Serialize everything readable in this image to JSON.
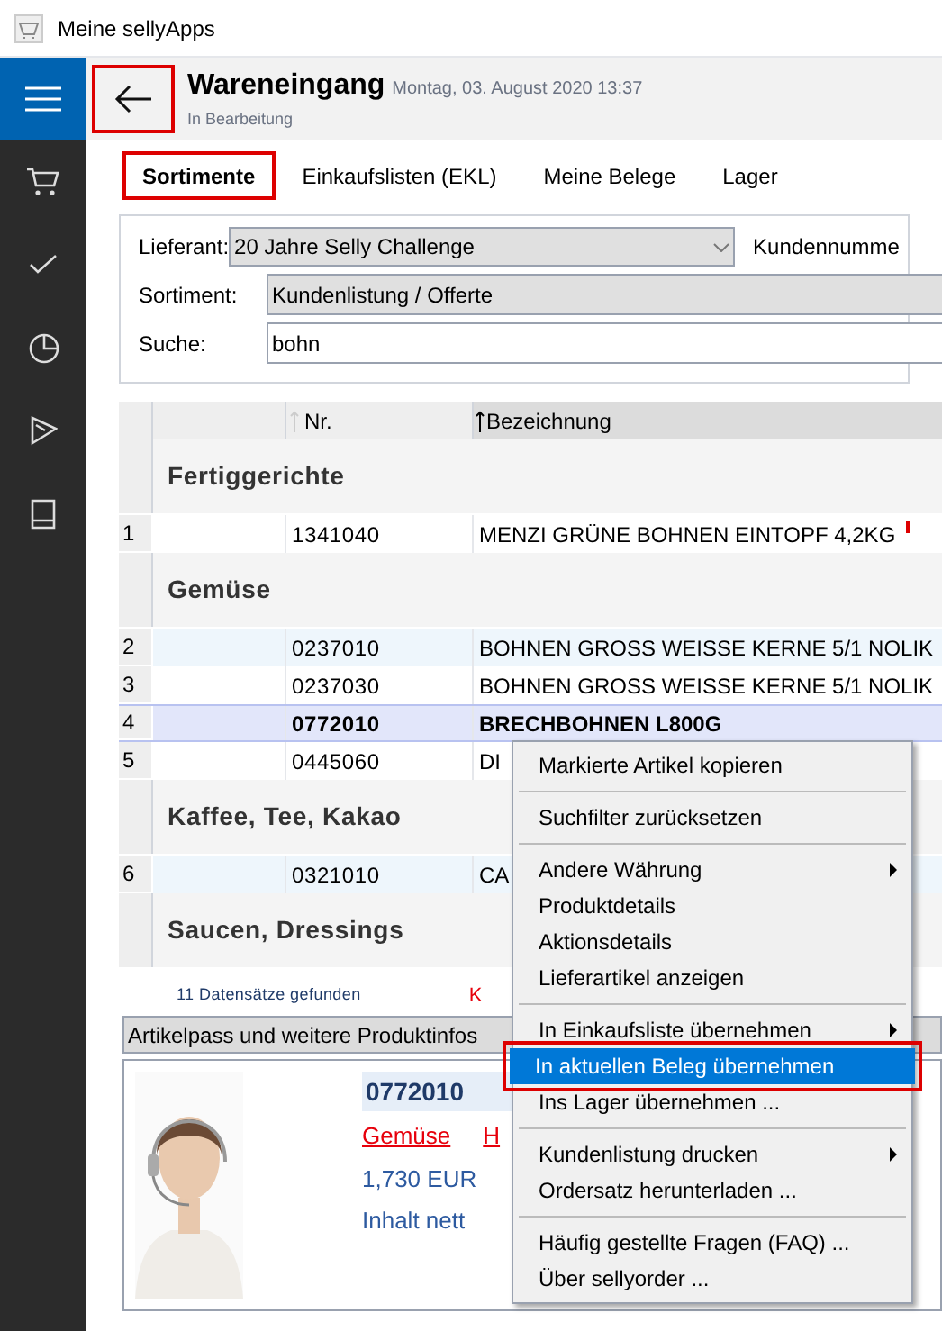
{
  "window": {
    "title": "Meine sellyApps"
  },
  "header": {
    "title": "Wareneingang",
    "date": "Montag, 03. August 2020 13:37",
    "status": "In Bearbeitung",
    "back_highlighted": true
  },
  "tabs": [
    {
      "label": "Sortimente",
      "selected": true,
      "highlighted": true
    },
    {
      "label": "Einkaufslisten (EKL)",
      "selected": false,
      "highlighted": false
    },
    {
      "label": "Meine Belege",
      "selected": false,
      "highlighted": false
    },
    {
      "label": "Lager",
      "selected": false,
      "highlighted": false
    }
  ],
  "filters": {
    "lieferant_label": "Lieferant:",
    "lieferant_value": "20 Jahre Selly Challenge",
    "kunden_label": "Kundennumme",
    "sortiment_label": "Sortiment:",
    "sortiment_value": "Kundenlistung / Offerte",
    "suche_label": "Suche:",
    "suche_value": "bohn"
  },
  "table": {
    "columns": [
      "Nr.",
      "Bezeichnung"
    ],
    "rows": [
      {
        "kind": "group",
        "title": "Fertiggerichte"
      },
      {
        "kind": "item",
        "index": "1",
        "nr": "1341040",
        "name": "MENZI GRÜNE BOHNEN EINTOPF 4,2KG",
        "info": true,
        "selected": false,
        "shaded": false
      },
      {
        "kind": "group",
        "title": "Gemüse"
      },
      {
        "kind": "item",
        "index": "2",
        "nr": "0237010",
        "name": "BOHNEN GROSS WEISSE KERNE 5/1 NOLIK",
        "info": false,
        "selected": false,
        "shaded": true
      },
      {
        "kind": "item",
        "index": "3",
        "nr": "0237030",
        "name": "BOHNEN GROSS WEISSE KERNE 5/1 NOLIK",
        "info": false,
        "selected": false,
        "shaded": false
      },
      {
        "kind": "item",
        "index": "4",
        "nr": "0772010",
        "name": "BRECHBOHNEN L800G",
        "info": false,
        "selected": true,
        "shaded": false
      },
      {
        "kind": "item",
        "index": "5",
        "nr": "0445060",
        "name": "DI",
        "info": false,
        "selected": false,
        "shaded": false
      },
      {
        "kind": "group",
        "title": "Kaffee, Tee, Kakao"
      },
      {
        "kind": "item",
        "index": "6",
        "nr": "0321010",
        "name": "CA",
        "info": false,
        "selected": false,
        "shaded": true
      },
      {
        "kind": "group",
        "title": "Saucen, Dressings"
      }
    ]
  },
  "footer": {
    "count": "11 Datensätze gefunden",
    "link": "K"
  },
  "product_panel": {
    "title": "Artikelpass und weitere Produktinfos",
    "nr": "0772010",
    "category": "Gemüse",
    "category_2": "H",
    "price": "1,730 EUR",
    "content": "Inhalt nett"
  },
  "context_menu": [
    {
      "kind": "item",
      "label": "Markierte Artikel kopieren",
      "submenu": false,
      "selected": false,
      "highlighted": false
    },
    {
      "kind": "separator"
    },
    {
      "kind": "item",
      "label": "Suchfilter zurücksetzen",
      "submenu": false,
      "selected": false,
      "highlighted": false
    },
    {
      "kind": "separator"
    },
    {
      "kind": "item",
      "label": "Andere Währung",
      "submenu": true,
      "selected": false,
      "highlighted": false
    },
    {
      "kind": "item",
      "label": "Produktdetails",
      "submenu": false,
      "selected": false,
      "highlighted": false
    },
    {
      "kind": "item",
      "label": "Aktionsdetails",
      "submenu": false,
      "selected": false,
      "highlighted": false
    },
    {
      "kind": "item",
      "label": "Lieferartikel anzeigen",
      "submenu": false,
      "selected": false,
      "highlighted": false
    },
    {
      "kind": "separator"
    },
    {
      "kind": "item",
      "label": "In Einkaufsliste übernehmen",
      "submenu": true,
      "selected": false,
      "highlighted": false
    },
    {
      "kind": "item",
      "label": "In aktuellen Beleg übernehmen",
      "submenu": false,
      "selected": true,
      "highlighted": true
    },
    {
      "kind": "item",
      "label": "Ins Lager übernehmen ...",
      "submenu": false,
      "selected": false,
      "highlighted": false
    },
    {
      "kind": "separator"
    },
    {
      "kind": "item",
      "label": "Kundenlistung drucken",
      "submenu": true,
      "selected": false,
      "highlighted": false
    },
    {
      "kind": "item",
      "label": "Ordersatz herunterladen ...",
      "submenu": false,
      "selected": false,
      "highlighted": false
    },
    {
      "kind": "separator"
    },
    {
      "kind": "item",
      "label": "Häufig gestellte Fragen (FAQ) ...",
      "submenu": false,
      "selected": false,
      "highlighted": false
    },
    {
      "kind": "item",
      "label": "Über sellyorder ...",
      "submenu": false,
      "selected": false,
      "highlighted": false
    }
  ]
}
